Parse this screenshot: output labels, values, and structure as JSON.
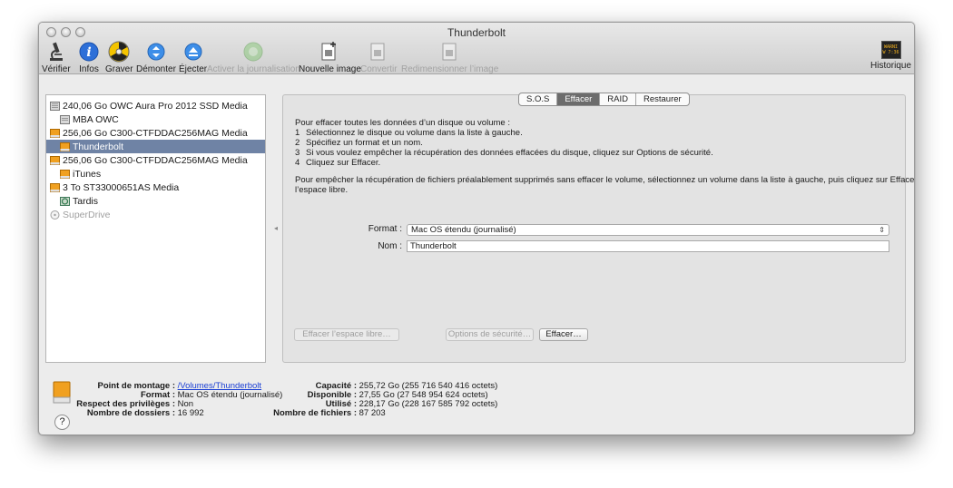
{
  "window": {
    "title": "Thunderbolt"
  },
  "toolbar": {
    "items": [
      {
        "label": "Vérifier",
        "icon": "microscope-icon",
        "enabled": true
      },
      {
        "label": "Infos",
        "icon": "info-icon",
        "enabled": true
      },
      {
        "label": "Graver",
        "icon": "burn-icon",
        "enabled": true
      },
      {
        "label": "Démonter",
        "icon": "unmount-icon",
        "enabled": true
      },
      {
        "label": "Éjecter",
        "icon": "eject-icon",
        "enabled": true
      },
      {
        "label": "Activer la journalisation",
        "icon": "journal-icon",
        "enabled": false
      },
      {
        "label": "Nouvelle image",
        "icon": "new-image-icon",
        "enabled": true
      },
      {
        "label": "Convertir",
        "icon": "convert-icon",
        "enabled": false
      },
      {
        "label": "Redimensionner l’image",
        "icon": "resize-image-icon",
        "enabled": false
      }
    ],
    "log": {
      "label": "Historique",
      "icon_text_1": "WARNI",
      "icon_text_2": "W 7:36"
    }
  },
  "sidebar": {
    "items": [
      {
        "label": "240,06 Go OWC Aura Pro 2012 SSD Media",
        "indent": 0,
        "kind": "disk"
      },
      {
        "label": "MBA OWC",
        "indent": 1,
        "kind": "volume"
      },
      {
        "label": "256,06 Go C300-CTFDDAC256MAG Media",
        "indent": 0,
        "kind": "disk-orange"
      },
      {
        "label": "Thunderbolt",
        "indent": 1,
        "kind": "volume-orange",
        "selected": true
      },
      {
        "label": "256,06 Go C300-CTFDDAC256MAG Media",
        "indent": 0,
        "kind": "disk-orange"
      },
      {
        "label": "iTunes",
        "indent": 1,
        "kind": "volume-orange"
      },
      {
        "label": "3 To ST33000651AS Media",
        "indent": 0,
        "kind": "disk-orange"
      },
      {
        "label": "Tardis",
        "indent": 1,
        "kind": "volume-green"
      },
      {
        "label": "SuperDrive",
        "indent": 0,
        "kind": "optical",
        "dim": true
      }
    ]
  },
  "tabs": [
    {
      "label": "S.O.S",
      "active": false
    },
    {
      "label": "Effacer",
      "active": true
    },
    {
      "label": "RAID",
      "active": false
    },
    {
      "label": "Restaurer",
      "active": false
    }
  ],
  "erase": {
    "intro": "Pour effacer toutes les données d’un disque ou volume :",
    "steps": [
      {
        "num": "1",
        "text": "Sélectionnez le disque ou volume dans la liste à gauche."
      },
      {
        "num": "2",
        "text": "Spécifiez un format et un nom."
      },
      {
        "num": "3",
        "text": "Si vous voulez empêcher la récupération des données effacées du disque, cliquez sur Options de sécurité."
      },
      {
        "num": "4",
        "text": "Cliquez sur Effacer."
      }
    ],
    "note_line1": "Pour empêcher la récupération de fichiers préalablement supprimés sans effacer le volume, sélectionnez un volume dans la liste à gauche, puis cliquez sur Effacer",
    "note_line2": "l’espace libre.",
    "format_label": "Format :",
    "format_value": "Mac OS étendu (journalisé)",
    "name_label": "Nom :",
    "name_value": "Thunderbolt",
    "btn_free_space": "Effacer l’espace libre…",
    "btn_security": "Options de sécurité…",
    "btn_erase": "Effacer…"
  },
  "info": {
    "left": [
      {
        "key": "Point de montage :",
        "value": "/Volumes/Thunderbolt",
        "link": true
      },
      {
        "key": "Format :",
        "value": "Mac OS étendu (journalisé)"
      },
      {
        "key": "Respect des privilèges :",
        "value": "Non"
      },
      {
        "key": "Nombre de dossiers :",
        "value": "16 992"
      }
    ],
    "right": [
      {
        "key": "Capacité :",
        "value": "255,72 Go (255 716 540 416 octets)"
      },
      {
        "key": "Disponible :",
        "value": "27,55 Go (27 548 954 624 octets)"
      },
      {
        "key": "Utilisé :",
        "value": "228,17 Go (228 167 585 792 octets)"
      },
      {
        "key": "Nombre de fichiers :",
        "value": "87 203"
      }
    ],
    "help": "?"
  }
}
